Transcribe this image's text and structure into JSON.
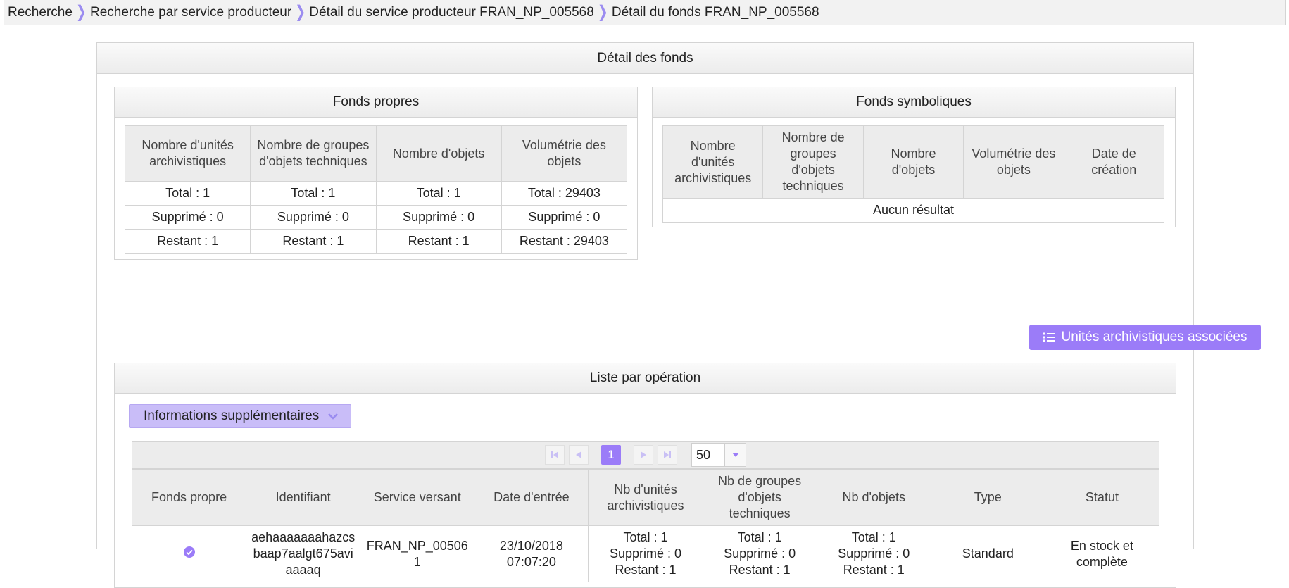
{
  "breadcrumb": {
    "items": [
      "Recherche",
      "Recherche par service producteur",
      "Détail du service producteur FRAN_NP_005568",
      "Détail du fonds FRAN_NP_005568"
    ],
    "separator_color": "#9b8cf0"
  },
  "panel": {
    "title": "Détail des fonds"
  },
  "fonds_propres": {
    "title": "Fonds propres",
    "headers": [
      "Nombre d'unités archivistiques",
      "Nombre de groupes d'objets techniques",
      "Nombre d'objets",
      "Volumétrie des objets"
    ],
    "rows": [
      [
        "Total : 1",
        "Total : 1",
        "Total : 1",
        "Total : 29403"
      ],
      [
        "Supprimé : 0",
        "Supprimé : 0",
        "Supprimé : 0",
        "Supprimé : 0"
      ],
      [
        "Restant : 1",
        "Restant : 1",
        "Restant : 1",
        "Restant : 29403"
      ]
    ]
  },
  "fonds_symboliques": {
    "title": "Fonds symboliques",
    "headers": [
      "Nombre d'unités archivistiques",
      "Nombre de groupes d'objets techniques",
      "Nombre d'objets",
      "Volumétrie des objets",
      "Date de création"
    ],
    "empty_text": "Aucun résultat"
  },
  "units_button": {
    "label": "Unités archivistiques associées",
    "icon": "list-icon",
    "color": "#9b7cf8"
  },
  "operations": {
    "title": "Liste par opération",
    "info_button": "Informations supplémentaires",
    "pagination": {
      "current_page": "1",
      "page_size": "50"
    },
    "headers": [
      "Fonds propre",
      "Identifiant",
      "Service versant",
      "Date d'entrée",
      "Nb d'unités archivistiques",
      "Nb de groupes d'objets techniques",
      "Nb d'objets",
      "Type",
      "Statut"
    ],
    "rows": [
      {
        "fonds_propre": "check-circle-icon",
        "identifiant": "aehaaaaaaahazcsbaap7aalgt675aviaaaaq",
        "service_versant": "FRAN_NP_005061",
        "date_entree_1": "23/10/2018",
        "date_entree_2": "07:07:20",
        "nb_ua": [
          "Total : 1",
          "Supprimé : 0",
          "Restant : 1"
        ],
        "nb_got": [
          "Total : 1",
          "Supprimé : 0",
          "Restant : 1"
        ],
        "nb_objets": [
          "Total : 1",
          "Supprimé : 0",
          "Restant : 1"
        ],
        "type": "Standard",
        "statut": "En stock et complète"
      }
    ]
  }
}
